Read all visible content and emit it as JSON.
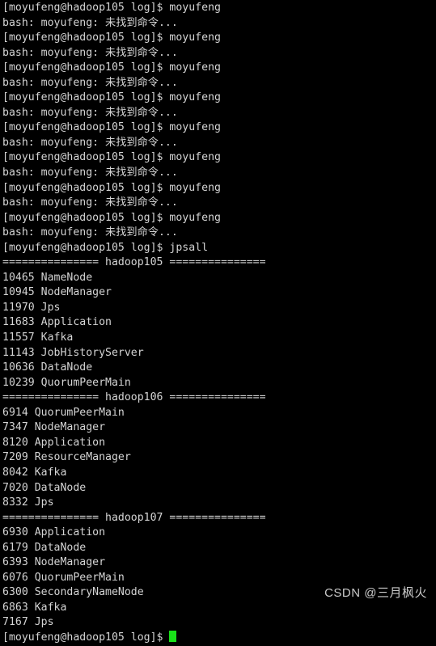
{
  "terminal": {
    "background_color": "#000000",
    "text_color": "#d4d4d4",
    "cursor_color": "#19e019",
    "prompt_string": "[moyufeng@hadoop105 log]$ ",
    "lines": [
      {
        "type": "prompt",
        "text": "[moyufeng@hadoop105 log]$ moyufeng"
      },
      {
        "type": "err",
        "text": "bash: moyufeng: 未找到命令..."
      },
      {
        "type": "prompt",
        "text": "[moyufeng@hadoop105 log]$ moyufeng"
      },
      {
        "type": "err",
        "text": "bash: moyufeng: 未找到命令..."
      },
      {
        "type": "prompt",
        "text": "[moyufeng@hadoop105 log]$ moyufeng"
      },
      {
        "type": "err",
        "text": "bash: moyufeng: 未找到命令..."
      },
      {
        "type": "prompt",
        "text": "[moyufeng@hadoop105 log]$ moyufeng"
      },
      {
        "type": "err",
        "text": "bash: moyufeng: 未找到命令..."
      },
      {
        "type": "prompt",
        "text": "[moyufeng@hadoop105 log]$ moyufeng"
      },
      {
        "type": "err",
        "text": "bash: moyufeng: 未找到命令..."
      },
      {
        "type": "prompt",
        "text": "[moyufeng@hadoop105 log]$ moyufeng"
      },
      {
        "type": "err",
        "text": "bash: moyufeng: 未找到命令..."
      },
      {
        "type": "prompt",
        "text": "[moyufeng@hadoop105 log]$ moyufeng"
      },
      {
        "type": "err",
        "text": "bash: moyufeng: 未找到命令..."
      },
      {
        "type": "prompt",
        "text": "[moyufeng@hadoop105 log]$ moyufeng"
      },
      {
        "type": "err",
        "text": "bash: moyufeng: 未找到命令..."
      },
      {
        "type": "prompt",
        "text": "[moyufeng@hadoop105 log]$ jpsall"
      },
      {
        "type": "sep",
        "text": "=============== hadoop105 ==============="
      },
      {
        "type": "proc",
        "text": "10465 NameNode"
      },
      {
        "type": "proc",
        "text": "10945 NodeManager"
      },
      {
        "type": "proc",
        "text": "11970 Jps"
      },
      {
        "type": "proc",
        "text": "11683 Application"
      },
      {
        "type": "proc",
        "text": "11557 Kafka"
      },
      {
        "type": "proc",
        "text": "11143 JobHistoryServer"
      },
      {
        "type": "proc",
        "text": "10636 DataNode"
      },
      {
        "type": "proc",
        "text": "10239 QuorumPeerMain"
      },
      {
        "type": "sep",
        "text": "=============== hadoop106 ==============="
      },
      {
        "type": "proc",
        "text": "6914 QuorumPeerMain"
      },
      {
        "type": "proc",
        "text": "7347 NodeManager"
      },
      {
        "type": "proc",
        "text": "8120 Application"
      },
      {
        "type": "proc",
        "text": "7209 ResourceManager"
      },
      {
        "type": "proc",
        "text": "8042 Kafka"
      },
      {
        "type": "proc",
        "text": "7020 DataNode"
      },
      {
        "type": "proc",
        "text": "8332 Jps"
      },
      {
        "type": "sep",
        "text": "=============== hadoop107 ==============="
      },
      {
        "type": "proc",
        "text": "6930 Application"
      },
      {
        "type": "proc",
        "text": "6179 DataNode"
      },
      {
        "type": "proc",
        "text": "6393 NodeManager"
      },
      {
        "type": "proc",
        "text": "6076 QuorumPeerMain"
      },
      {
        "type": "proc",
        "text": "6300 SecondaryNameNode"
      },
      {
        "type": "proc",
        "text": "6863 Kafka"
      },
      {
        "type": "proc",
        "text": "7167 Jps"
      }
    ],
    "final_prompt": "[moyufeng@hadoop105 log]$ "
  },
  "watermark": {
    "text": "CSDN @三月枫火"
  },
  "hosts": [
    {
      "name": "hadoop105",
      "processes": [
        {
          "pid": "10465",
          "name": "NameNode"
        },
        {
          "pid": "10945",
          "name": "NodeManager"
        },
        {
          "pid": "11970",
          "name": "Jps"
        },
        {
          "pid": "11683",
          "name": "Application"
        },
        {
          "pid": "11557",
          "name": "Kafka"
        },
        {
          "pid": "11143",
          "name": "JobHistoryServer"
        },
        {
          "pid": "10636",
          "name": "DataNode"
        },
        {
          "pid": "10239",
          "name": "QuorumPeerMain"
        }
      ]
    },
    {
      "name": "hadoop106",
      "processes": [
        {
          "pid": "6914",
          "name": "QuorumPeerMain"
        },
        {
          "pid": "7347",
          "name": "NodeManager"
        },
        {
          "pid": "8120",
          "name": "Application"
        },
        {
          "pid": "7209",
          "name": "ResourceManager"
        },
        {
          "pid": "8042",
          "name": "Kafka"
        },
        {
          "pid": "7020",
          "name": "DataNode"
        },
        {
          "pid": "8332",
          "name": "Jps"
        }
      ]
    },
    {
      "name": "hadoop107",
      "processes": [
        {
          "pid": "6930",
          "name": "Application"
        },
        {
          "pid": "6179",
          "name": "DataNode"
        },
        {
          "pid": "6393",
          "name": "NodeManager"
        },
        {
          "pid": "6076",
          "name": "QuorumPeerMain"
        },
        {
          "pid": "6300",
          "name": "SecondaryNameNode"
        },
        {
          "pid": "6863",
          "name": "Kafka"
        },
        {
          "pid": "7167",
          "name": "Jps"
        }
      ]
    }
  ],
  "commands_run": [
    "moyufeng",
    "jpsall"
  ]
}
